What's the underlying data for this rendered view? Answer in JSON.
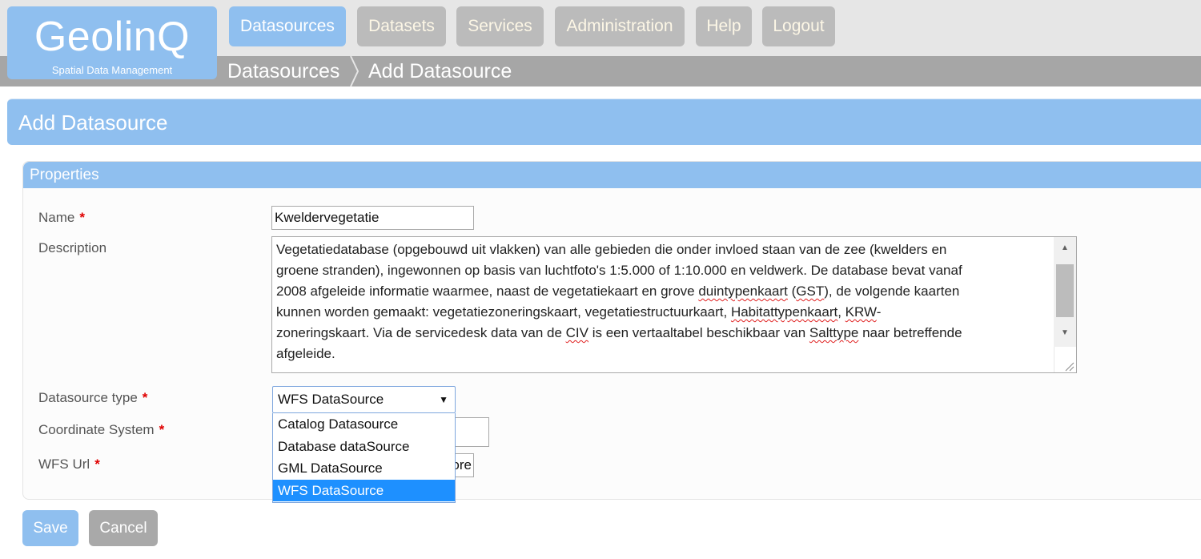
{
  "app": {
    "logo_name": "GeolinQ",
    "logo_tagline": "Spatial Data Management"
  },
  "nav": {
    "items": [
      {
        "label": "Datasources",
        "active": true
      },
      {
        "label": "Datasets",
        "active": false
      },
      {
        "label": "Services",
        "active": false
      },
      {
        "label": "Administration",
        "active": false
      },
      {
        "label": "Help",
        "active": false
      },
      {
        "label": "Logout",
        "active": false
      }
    ]
  },
  "breadcrumb": [
    "Datasources",
    "Add Datasource"
  ],
  "page": {
    "title": "Add Datasource"
  },
  "properties": {
    "heading": "Properties",
    "required_marker": "*",
    "name": {
      "label": "Name",
      "value": "Kweldervegetatie"
    },
    "description": {
      "label": "Description",
      "value": "Vegetatiedatabase (opgebouwd uit vlakken) van alle gebieden die onder invloed staan van de zee (kwelders en groene stranden), ingewonnen op basis van luchtfoto's 1:5.000 of 1:10.000 en veldwerk. De database bevat vanaf 2008 afgeleide informatie waarmee, naast de vegetatiekaart en grove duintypenkaart (GST), de volgende kaarten kunnen worden gemaakt: vegetatiezoneringskaart, vegetatiestructuurkaart, Habitattypenkaart, KRW-zoneringskaart. Via de servicedesk data van de CIV is een vertaaltabel beschikbaar van Salttype naar betreffende afgeleide.",
      "lines": [
        [
          {
            "t": "Vegetatiedatabase (opgebouwd uit vlakken) van alle gebieden die onder invloed staan van de zee (kwelders en",
            "s": false
          }
        ],
        [
          {
            "t": "groene stranden), ingewonnen op basis van luchtfoto's 1:5.000 of 1:10.000 en veldwerk. De database bevat vanaf",
            "s": false
          }
        ],
        [
          {
            "t": "2008 afgeleide informatie waarmee, naast de vegetatiekaart en grove ",
            "s": false
          },
          {
            "t": "duintypenkaart",
            "s": true
          },
          {
            "t": " (",
            "s": false
          },
          {
            "t": "GST",
            "s": true
          },
          {
            "t": "), de volgende kaarten",
            "s": false
          }
        ],
        [
          {
            "t": "kunnen worden gemaakt: vegetatiezoneringskaart, vegetatiestructuurkaart, ",
            "s": false
          },
          {
            "t": "Habitattypenkaart",
            "s": true
          },
          {
            "t": ", ",
            "s": false
          },
          {
            "t": "KRW",
            "s": true
          },
          {
            "t": "-",
            "s": false
          }
        ],
        [
          {
            "t": "zoneringskaart. Via de servicedesk data van de ",
            "s": false
          },
          {
            "t": "CIV",
            "s": true
          },
          {
            "t": " is een vertaaltabel beschikbaar van ",
            "s": false
          },
          {
            "t": "Salttype",
            "s": true
          },
          {
            "t": " naar betreffende",
            "s": false
          }
        ],
        [
          {
            "t": "afgeleide.",
            "s": false
          }
        ]
      ]
    },
    "datasource_type": {
      "label": "Datasource type",
      "value": "WFS DataSource",
      "options": [
        "Catalog Datasource",
        "Database dataSource",
        "GML DataSource",
        "WFS DataSource"
      ],
      "highlighted": "WFS DataSource"
    },
    "coordinate_system": {
      "label": "Coordinate System",
      "value": ""
    },
    "wfs_url": {
      "label": "WFS Url",
      "visible_value_tail": "ore"
    }
  },
  "actions": {
    "save_label": "Save",
    "cancel_label": "Cancel"
  },
  "colors": {
    "accent_blue": "#8fbfef",
    "nav_gray": "#bbbbbb",
    "breadcrumb_gray": "#a6a6a6",
    "selected_option": "#1e90ff",
    "required_red": "#e00000"
  }
}
